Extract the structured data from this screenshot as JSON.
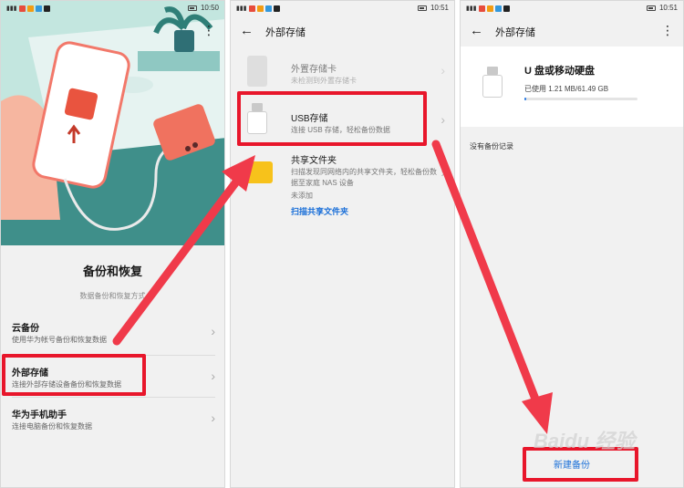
{
  "status_bar": {
    "time_1": "10:50",
    "time_2": "10:51",
    "time_3": "10:51"
  },
  "screen1": {
    "title": "备份和恢复",
    "subtitle": "数据备份和恢复方式",
    "items": [
      {
        "title": "云备份",
        "subtitle": "使用华为帐号备份和恢复数据"
      },
      {
        "title": "外部存储",
        "subtitle": "连接外部存储设备备份和恢复数据"
      },
      {
        "title": "华为手机助手",
        "subtitle": "连接电脑备份和恢复数据"
      }
    ]
  },
  "screen2": {
    "title": "外部存储",
    "items": [
      {
        "title": "外置存储卡",
        "subtitle": "未检测到外置存储卡"
      },
      {
        "title": "USB存储",
        "subtitle": "连接 USB 存储，轻松备份数据"
      },
      {
        "title": "共享文件夹",
        "subtitle": "扫描发现同网络内的共享文件夹，轻松备份数据至家庭 NAS 设备",
        "status": "未添加",
        "link": "扫描共享文件夹"
      }
    ]
  },
  "screen3": {
    "title": "外部存储",
    "device_name": "U 盘或移动硬盘",
    "usage_text": "已使用 1.21 MB/61.49 GB",
    "usage_fraction": 0.02,
    "empty_text": "没有备份记录",
    "action": "新建备份"
  },
  "colors": {
    "highlight": "#e8162b",
    "arrow": "#f03a4a",
    "link": "#1a6fd8",
    "accent": "#2a7be4"
  }
}
